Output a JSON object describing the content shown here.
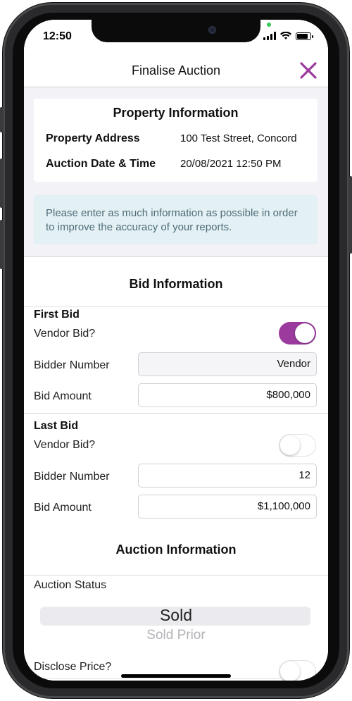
{
  "status_bar": {
    "time": "12:50"
  },
  "nav": {
    "title": "Finalise Auction",
    "close_icon": "close-icon",
    "accent_color": "#9b3b9d"
  },
  "property_info": {
    "title": "Property Information",
    "rows": [
      {
        "label": "Property Address",
        "value": "100 Test Street, Concord"
      },
      {
        "label": "Auction Date & Time",
        "value": "20/08/2021 12:50 PM"
      }
    ]
  },
  "notice": {
    "text": "Please enter as much information as possible in order to improve the accuracy of your reports."
  },
  "bid_info": {
    "title": "Bid Information",
    "first_bid": {
      "heading": "First Bid",
      "vendor_bid_label": "Vendor Bid?",
      "vendor_bid_on": true,
      "bidder_number_label": "Bidder Number",
      "bidder_number_value": "Vendor",
      "bid_amount_label": "Bid Amount",
      "bid_amount_value": "$800,000"
    },
    "last_bid": {
      "heading": "Last Bid",
      "vendor_bid_label": "Vendor Bid?",
      "vendor_bid_on": false,
      "bidder_number_label": "Bidder Number",
      "bidder_number_value": "12",
      "bid_amount_label": "Bid Amount",
      "bid_amount_value": "$1,100,000"
    }
  },
  "auction_info": {
    "title": "Auction Information",
    "status_label": "Auction Status",
    "status_options": [
      "Sold",
      "Sold Prior"
    ],
    "status_selected": "Sold",
    "disclose_price_label": "Disclose Price?",
    "disclose_price_on": false
  }
}
